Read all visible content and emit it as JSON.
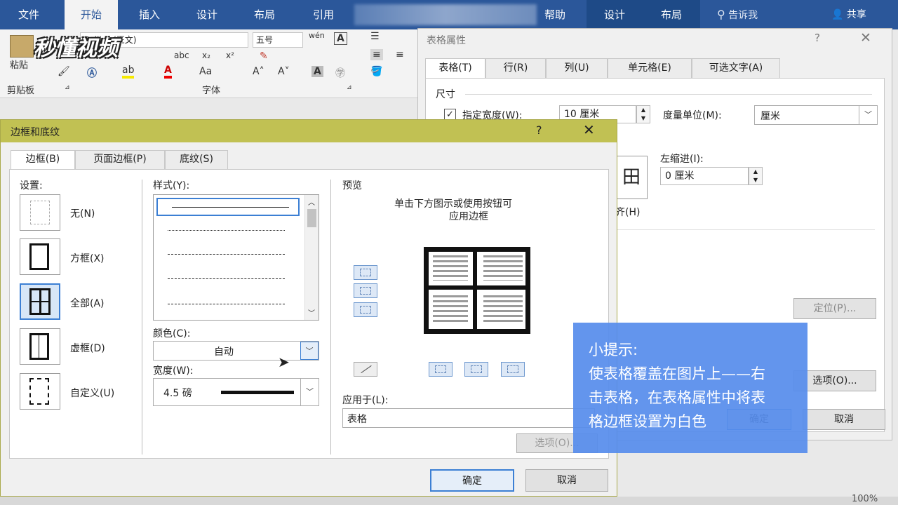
{
  "ribbon": {
    "tabs": [
      "文件",
      "开始",
      "插入",
      "设计",
      "布局",
      "引用",
      "帮助"
    ],
    "context_tabs": [
      "设计",
      "布局"
    ],
    "active_tab": "开始",
    "tell_me": "告诉我",
    "share": "共享",
    "logo": "秒懂视频",
    "paste_label": "粘贴",
    "group_clipboard": "剪贴板",
    "group_font": "字体",
    "font_name": "Calibri (正文)",
    "font_size": "五号"
  },
  "table_props": {
    "title": "表格属性",
    "help": "?",
    "tabs": [
      "表格(T)",
      "行(R)",
      "列(U)",
      "单元格(E)",
      "可选文字(A)"
    ],
    "size_label": "尺寸",
    "pref_width_label": "指定宽度(W):",
    "pref_width_value": "10 厘米",
    "measure_label": "度量单位(M):",
    "measure_value": "厘米",
    "indent_label": "左缩进(I):",
    "indent_value": "0 厘米",
    "align_partial": "齐(H)",
    "position_button": "定位(P)...",
    "options_button": "选项(O)...",
    "ok_button": "确定",
    "cancel_button": "取消"
  },
  "borders_dialog": {
    "title": "边框和底纹",
    "help": "?",
    "tabs": [
      "边框(B)",
      "页面边框(P)",
      "底纹(S)"
    ],
    "settings_label": "设置:",
    "settings": [
      "无(N)",
      "方框(X)",
      "全部(A)",
      "虚框(D)",
      "自定义(U)"
    ],
    "style_label": "样式(Y):",
    "color_label": "颜色(C):",
    "color_value": "自动",
    "width_label": "宽度(W):",
    "width_value": "4.5 磅",
    "preview_label": "预览",
    "preview_hint_1": "单击下方图示或使用按钮可",
    "preview_hint_2": "应用边框",
    "apply_label": "应用于(L):",
    "apply_value": "表格",
    "options_button": "选项(O)...",
    "ok_button": "确定",
    "cancel_button": "取消"
  },
  "tip": {
    "heading": "小提示:",
    "line1": "使表格覆盖在图片上——右",
    "line2": "击表格，在表格属性中将表",
    "line3": "格边框设置为白色"
  },
  "status": {
    "zoom": "100%"
  },
  "colors": {
    "ribbon_blue": "#2b579a",
    "dialog_title_olive": "#c1c153",
    "tip_blue": "#568cec",
    "selected_blue": "#3c7fd4"
  }
}
